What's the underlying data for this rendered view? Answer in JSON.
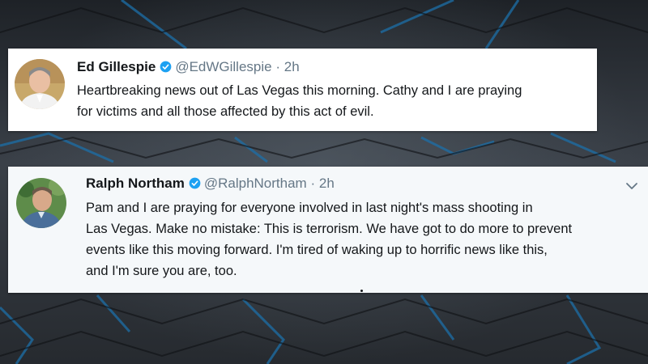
{
  "tweets": [
    {
      "name": "Ed Gillespie",
      "handle": "@EdWGillespie",
      "separator": "·",
      "time": "2h",
      "lines": [
        "Heartbreaking news out of Las Vegas this morning. Cathy and I are praying",
        "for victims and all those affected by this act of evil."
      ],
      "verified_icon": "verified-badge-icon",
      "avatar_icon": "avatar-photo"
    },
    {
      "name": "Ralph Northam",
      "handle": "@RalphNortham",
      "separator": "·",
      "time": "2h",
      "lines": [
        "Pam and I are praying for everyone involved in last night's mass shooting in",
        "Las Vegas. Make no mistake: This is terrorism. We have got to do more to prevent",
        "events like this moving forward. I'm tired of waking up to horrific news like this,",
        "and I'm sure you are, too."
      ],
      "verified_icon": "verified-badge-icon",
      "avatar_icon": "avatar-photo",
      "menu_icon": "chevron-down-icon"
    }
  ],
  "colors": {
    "verified": "#1da1f2",
    "muted": "#657786",
    "text": "#14171a",
    "background": "#2b3036"
  }
}
